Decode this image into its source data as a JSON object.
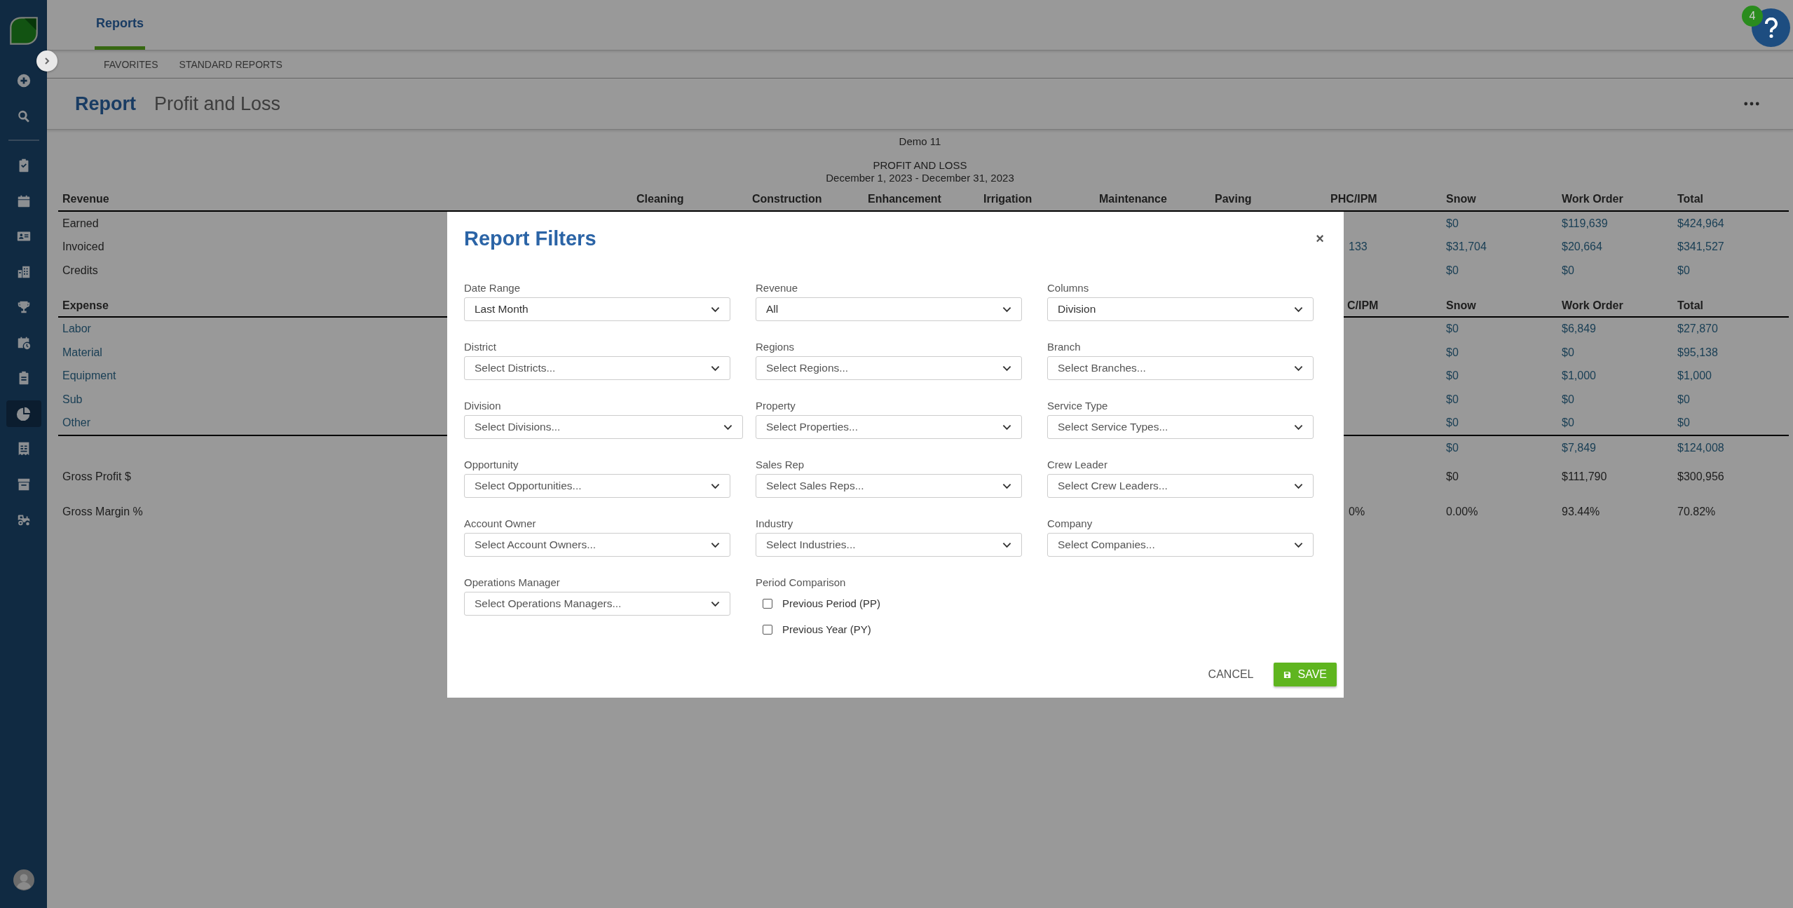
{
  "sidebar": {
    "items": [
      {
        "kind": "add",
        "selected": false
      },
      {
        "kind": "search",
        "selected": false
      },
      {
        "kind": "tasks",
        "selected": false
      },
      {
        "kind": "calendar",
        "selected": false
      },
      {
        "kind": "contacts",
        "selected": false
      },
      {
        "kind": "buildings",
        "selected": false
      },
      {
        "kind": "trophy",
        "selected": false
      },
      {
        "kind": "schedule",
        "selected": false
      },
      {
        "kind": "clipboard",
        "selected": false
      },
      {
        "kind": "reports",
        "selected": true
      },
      {
        "kind": "invoice",
        "selected": false
      },
      {
        "kind": "archive",
        "selected": false
      },
      {
        "kind": "equipment",
        "selected": false
      }
    ]
  },
  "tabs": [
    {
      "label": "Reports",
      "selected": true
    }
  ],
  "subnav": [
    "FAVORITES",
    "STANDARD REPORTS"
  ],
  "help": {
    "badge": "4"
  },
  "page": {
    "title": "Report",
    "subtitle": "Profit and Loss"
  },
  "report": {
    "company": "Demo 11",
    "heading": "PROFIT AND LOSS",
    "period": "December 1, 2023 - December 31, 2023",
    "columns": [
      "Cleaning",
      "Construction",
      "Enhancement",
      "Irrigation",
      "Maintenance",
      "Paving",
      "PHC/IPM",
      "Snow",
      "Work Order",
      "Total"
    ],
    "rows": [
      {
        "kind": "section",
        "label": "Revenue"
      },
      {
        "kind": "amount",
        "label": "Earned",
        "snow": "$0",
        "work_order": "$119,639",
        "total": "$424,964"
      },
      {
        "kind": "amount",
        "label": "Invoiced",
        "phc_ipm": "133",
        "snow": "$31,704",
        "work_order": "$20,664",
        "total": "$341,527"
      },
      {
        "kind": "amount",
        "label": "Credits",
        "snow": "$0",
        "work_order": "$0",
        "total": "$0"
      },
      {
        "kind": "section",
        "label": "Expense",
        "phc_ipm": "C/IPM",
        "snow": "Snow",
        "work_order": "Work Order",
        "total": "Total"
      },
      {
        "kind": "expense",
        "label": "Labor",
        "snow": "$0",
        "work_order": "$6,849",
        "total": "$27,870"
      },
      {
        "kind": "expense",
        "label": "Material",
        "snow": "$0",
        "work_order": "$0",
        "total": "$95,138"
      },
      {
        "kind": "expense",
        "label": "Equipment",
        "snow": "$0",
        "work_order": "$1,000",
        "total": "$1,000"
      },
      {
        "kind": "expense",
        "label": "Sub",
        "snow": "$0",
        "work_order": "$0",
        "total": "$0"
      },
      {
        "kind": "expense",
        "label": "Other",
        "snow": "$0",
        "work_order": "$0",
        "total": "$0"
      },
      {
        "kind": "total",
        "snow": "$0",
        "work_order": "$7,849",
        "total": "$124,008"
      },
      {
        "kind": "summary",
        "label": "Gross Profit $",
        "snow": "$0",
        "work_order": "$111,790",
        "total": "$300,956"
      },
      {
        "kind": "summary",
        "label": "Gross Margin %",
        "phc_ipm": "0%",
        "snow": "0.00%",
        "work_order": "93.44%",
        "total": "70.82%"
      }
    ]
  },
  "dialog": {
    "title": "Report Filters",
    "close": "×",
    "fields": [
      {
        "kind": "select",
        "label": "Date Range",
        "value": "Last Month"
      },
      {
        "kind": "select",
        "label": "Revenue",
        "value": "All"
      },
      {
        "kind": "select",
        "label": "Columns",
        "value": "Division"
      },
      {
        "kind": "select",
        "label": "District",
        "placeholder": "Select Districts..."
      },
      {
        "kind": "select",
        "label": "Regions",
        "placeholder": "Select Regions..."
      },
      {
        "kind": "select",
        "label": "Branch",
        "placeholder": "Select Branches..."
      },
      {
        "kind": "select",
        "label": "Division",
        "placeholder": "Select Divisions...",
        "wide": true
      },
      {
        "kind": "select",
        "label": "Property",
        "placeholder": "Select Properties..."
      },
      {
        "kind": "select",
        "label": "Service Type",
        "placeholder": "Select Service Types..."
      },
      {
        "kind": "select",
        "label": "Opportunity",
        "placeholder": "Select Opportunities..."
      },
      {
        "kind": "select",
        "label": "Sales Rep",
        "placeholder": "Select Sales Reps..."
      },
      {
        "kind": "select",
        "label": "Crew Leader",
        "placeholder": "Select Crew Leaders..."
      },
      {
        "kind": "select",
        "label": "Account Owner",
        "placeholder": "Select Account Owners..."
      },
      {
        "kind": "select",
        "label": "Industry",
        "placeholder": "Select Industries..."
      },
      {
        "kind": "select",
        "label": "Company",
        "placeholder": "Select Companies..."
      },
      {
        "kind": "select",
        "label": "Operations Manager",
        "placeholder": "Select Operations Managers..."
      },
      {
        "kind": "checks",
        "label": "Period Comparison",
        "options": [
          {
            "label": "Previous Period (PP)",
            "checked": false
          },
          {
            "label": "Previous Year (PY)",
            "checked": false
          }
        ]
      }
    ],
    "cancel": "CANCEL",
    "save": "SAVE"
  }
}
